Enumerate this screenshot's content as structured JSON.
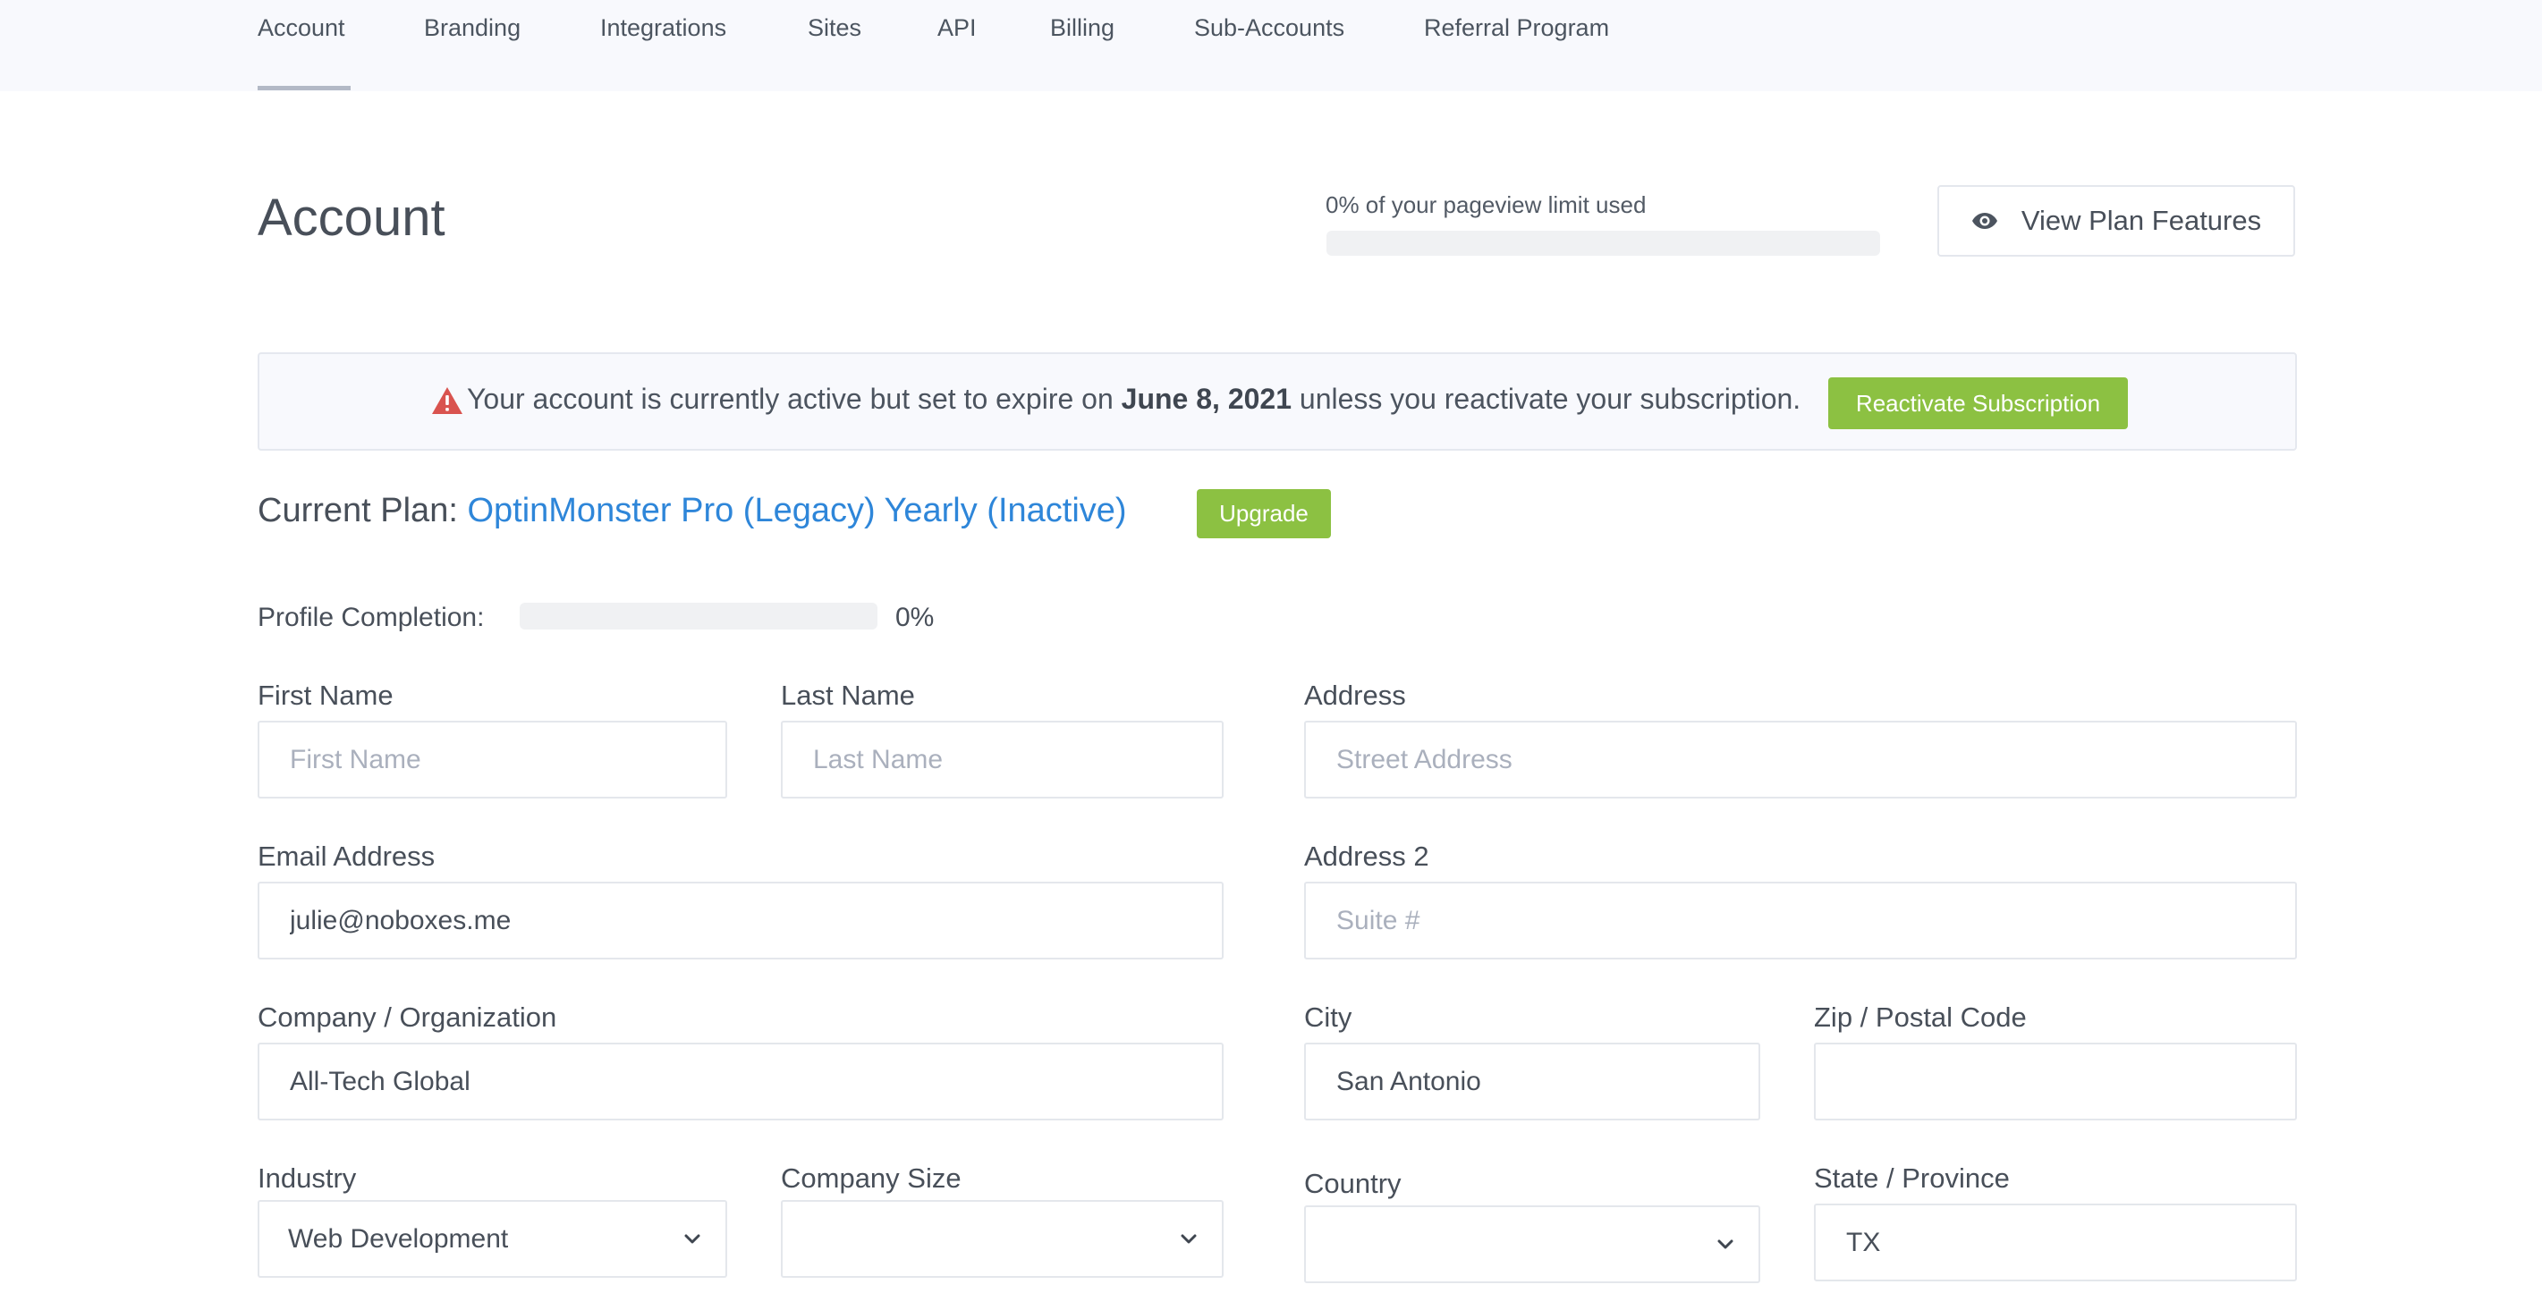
{
  "nav": {
    "items": [
      {
        "label": "Account",
        "active": true
      },
      {
        "label": "Branding"
      },
      {
        "label": "Integrations"
      },
      {
        "label": "Sites"
      },
      {
        "label": "API"
      },
      {
        "label": "Billing"
      },
      {
        "label": "Sub-Accounts"
      },
      {
        "label": "Referral Program"
      }
    ]
  },
  "header": {
    "title": "Account",
    "usage_text": "0% of your pageview limit used",
    "usage_percent": 0,
    "view_plan_label": "View Plan Features",
    "view_plan_icon": "eye-icon"
  },
  "alert": {
    "icon": "warning-icon",
    "text_before": "Your account is currently active but set to expire on",
    "expire_date": "June 8, 2021",
    "text_after": "unless you reactivate your subscription.",
    "button_label": "Reactivate Subscription"
  },
  "plan": {
    "label": "Current Plan:",
    "name": "OptinMonster Pro (Legacy) Yearly (Inactive)",
    "upgrade_label": "Upgrade"
  },
  "profile_completion": {
    "label": "Profile Completion:",
    "percent": 0,
    "value_text": "0%"
  },
  "form": {
    "first_name": {
      "label": "First Name",
      "placeholder": "First Name",
      "value": ""
    },
    "last_name": {
      "label": "Last Name",
      "placeholder": "Last Name",
      "value": ""
    },
    "email": {
      "label": "Email Address",
      "value": "julie@noboxes.me"
    },
    "company": {
      "label": "Company / Organization",
      "value": "All-Tech Global"
    },
    "industry": {
      "label": "Industry",
      "value": "Web Development"
    },
    "company_size": {
      "label": "Company Size",
      "value": ""
    },
    "address": {
      "label": "Address",
      "placeholder": "Street Address",
      "value": ""
    },
    "address2": {
      "label": "Address 2",
      "placeholder": "Suite #",
      "value": ""
    },
    "city": {
      "label": "City",
      "value": "San Antonio"
    },
    "zip": {
      "label": "Zip / Postal Code",
      "value": ""
    },
    "country": {
      "label": "Country",
      "value": ""
    },
    "state": {
      "label": "State / Province",
      "value": "TX"
    }
  },
  "colors": {
    "accent_green": "#8cc142",
    "link_blue": "#2e86d9",
    "warning_red": "#d9534f",
    "nav_bg": "#f8f9fd"
  }
}
